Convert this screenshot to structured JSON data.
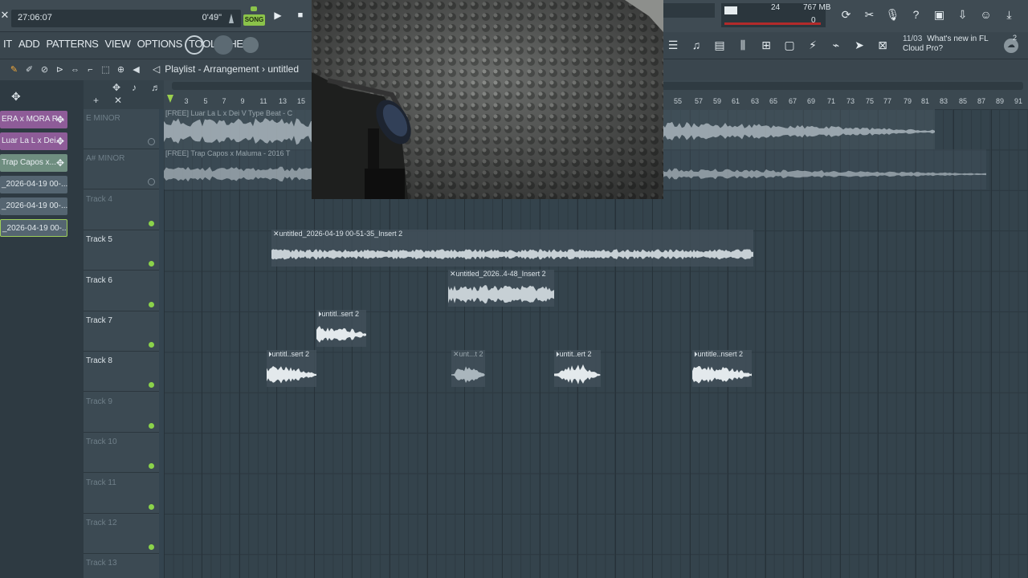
{
  "transport": {
    "time": "27:06:07",
    "duration": "0'49\"",
    "song_label": "SONG",
    "play_icon": "play-icon",
    "stop_icon": "stop-icon"
  },
  "status": {
    "cpu_value": "24",
    "memory": "767 MB",
    "polyphony": "0"
  },
  "menu": [
    "IT",
    "ADD",
    "PATTERNS",
    "VIEW",
    "OPTIONS",
    "TOOLS",
    "HELP"
  ],
  "news": {
    "count": "11/03",
    "text": "What's new in FL Cloud Pro?",
    "badge": "2"
  },
  "playlist": {
    "title": "Playlist - Arrangement",
    "separator": "›",
    "pattern": "untitled"
  },
  "browser_clips": [
    {
      "label": "ERA x MORA R...",
      "kind": "purple"
    },
    {
      "label": "Luar La L x Dei...",
      "kind": "purple"
    },
    {
      "label": "Trap Capos x...",
      "kind": "green"
    },
    {
      "label": "_2026-04-19 00-...",
      "kind": "pattern"
    },
    {
      "label": "_2026-04-19 00-...",
      "kind": "pattern"
    },
    {
      "label": "_2026-04-19 00-...",
      "kind": "pattern"
    }
  ],
  "tracks": [
    {
      "name": "E MINOR",
      "dim": true
    },
    {
      "name": "A# MINOR",
      "dim": true
    },
    {
      "name": "Track 4",
      "dim": true
    },
    {
      "name": "Track 5",
      "dim": false
    },
    {
      "name": "Track 6",
      "dim": false
    },
    {
      "name": "Track 7",
      "dim": false
    },
    {
      "name": "Track 8",
      "dim": false
    },
    {
      "name": "Track 9",
      "dim": true
    },
    {
      "name": "Track 10",
      "dim": true
    },
    {
      "name": "Track 11",
      "dim": true
    },
    {
      "name": "Track 12",
      "dim": true
    },
    {
      "name": "Track 13",
      "dim": true
    }
  ],
  "ruler_numbers": [
    "3",
    "5",
    "7",
    "9",
    "11",
    "13",
    "15",
    "55",
    "57",
    "59",
    "61",
    "63",
    "65",
    "67",
    "69",
    "71",
    "73",
    "75",
    "77",
    "79",
    "81",
    "83",
    "85",
    "87",
    "89",
    "91"
  ],
  "audio_clips": {
    "track1": "[FREE] Luar La L x Dei V Type Beat - C",
    "track2": "[FREE] Trap Capos x Maluma - 2016 T",
    "track5": "untitled_2026-04-19 00-51-35_Insert 2",
    "track6": "untitled_2026..4-48_Insert 2",
    "track7": "untitl..sert 2",
    "track8a": "untitl..sert 2",
    "track8b": "unt...t 2",
    "track8c": "untit..ert 2",
    "track8d": "untitle..nsert 2"
  },
  "colors": {
    "accent_green": "#8bc34a",
    "clip_purple": "#8e5c98",
    "clip_green": "#6f8e80",
    "cpu_red": "#b22a2a"
  }
}
